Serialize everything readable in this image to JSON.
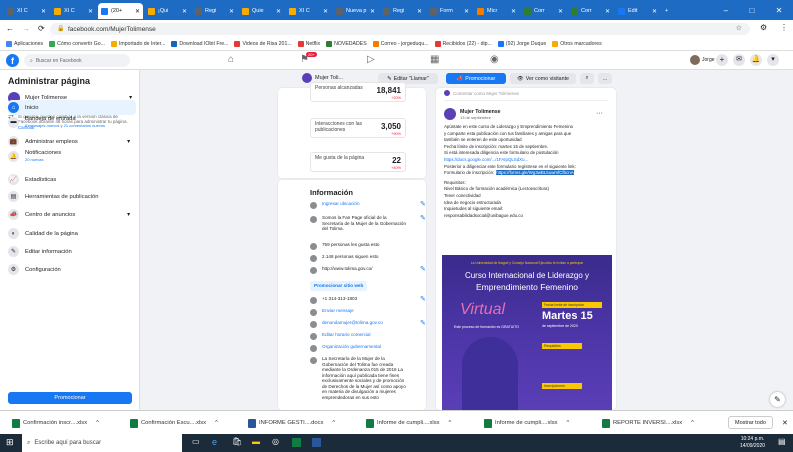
{
  "browser": {
    "tabs": [
      {
        "label": "XI C",
        "color": "#5f6368"
      },
      {
        "label": "XI C",
        "color": "#f9ab00"
      },
      {
        "label": "(20+",
        "color": "#1877f2",
        "active": true
      },
      {
        "label": "¡Qui",
        "color": "#f9ab00"
      },
      {
        "label": "Regi",
        "color": "#5f6368"
      },
      {
        "label": "Quie",
        "color": "#f9ab00"
      },
      {
        "label": "XI C",
        "color": "#f9ab00"
      },
      {
        "label": "Nueva p",
        "color": "#5f6368"
      },
      {
        "label": "Regi",
        "color": "#5f6368"
      },
      {
        "label": "Form",
        "color": "#5f6368"
      },
      {
        "label": "Micr",
        "color": "#f57c00"
      },
      {
        "label": "Corr",
        "color": "#2e7d32"
      },
      {
        "label": "Corr",
        "color": "#2e7d32"
      },
      {
        "label": "Edit",
        "color": "#1877f2"
      }
    ],
    "new_tab": "+",
    "url": "facebook.com/MujerTolimense",
    "bookmarks": [
      {
        "label": "Aplicaciones",
        "color": "#4285f4"
      },
      {
        "label": "Cómo convertir Go...",
        "color": "#34a853"
      },
      {
        "label": "Importado de Inter...",
        "color": "#f9ab00"
      },
      {
        "label": "Download IObit Fre...",
        "color": "#1565c0"
      },
      {
        "label": "Videos de Risa 201...",
        "color": "#e53935"
      },
      {
        "label": "Netflix",
        "color": "#e53935"
      },
      {
        "label": "NOVEDADES",
        "color": "#2e7d32"
      },
      {
        "label": "Correo - jorgeduqu...",
        "color": "#f57c00"
      },
      {
        "label": "Recibidos (22) - dip...",
        "color": "#e53935"
      },
      {
        "label": "(92) Jorge Duque",
        "color": "#1877f2"
      },
      {
        "label": "Otros marcadores",
        "color": "#f9ab00"
      }
    ]
  },
  "fb": {
    "search_placeholder": "Buscar en Facebook",
    "user": "Jorge",
    "notif_badge": "20+"
  },
  "sidebar": {
    "title": "Administrar página",
    "page_name": "Mujer Tolimense",
    "notice": "Si quieres, puedes cambiar a la versión clásica de Facebook durante 48 horas para administrar tu página.",
    "notice_link": "Cambiar",
    "items": [
      {
        "label": "Inicio"
      },
      {
        "label": "Bandeja de entrada",
        "sub": "6 mensajes nuevos y 21 comentarios nuevos"
      },
      {
        "label": "Administrar empleos"
      },
      {
        "label": "Notificaciones",
        "sub": "20 nuevas"
      },
      {
        "label": "Estadísticas"
      },
      {
        "label": "Herramientas de publicación"
      },
      {
        "label": "Centro de anuncios"
      },
      {
        "label": "Calidad de la página"
      },
      {
        "label": "Editar información"
      },
      {
        "label": "Configuración"
      }
    ],
    "promote": "Promocionar"
  },
  "header": {
    "page_short": "Mujer Toli...",
    "edit_btn": "Editar \"Llamar\"",
    "promote_btn": "Promocionar",
    "visitor_btn": "Ver como visitante",
    "more": "..."
  },
  "stats": [
    {
      "label": "Personas alcanzadas",
      "value": "18,841",
      "change": "+20%"
    },
    {
      "label": "Interacciones con las publicaciones",
      "value": "3,050",
      "change": "+90%"
    },
    {
      "label": "Me gusta de la página",
      "value": "22",
      "change": "+40%"
    }
  ],
  "info": {
    "title": "Información",
    "rows": [
      {
        "text": "Ingresar ubicación",
        "link": true
      },
      {
        "text": "Somos la Fan Page oficial de la Secretaría de la Mujer de la Gobernación del Tolima.",
        "link": false
      },
      {
        "text": "759 personas les gusta esto",
        "link": false
      },
      {
        "text": "2.148 personas siguen esto",
        "link": false
      },
      {
        "text": "http://www.tolima.gov.co/",
        "link": false
      },
      {
        "text": "Promocionar sitio web",
        "link": true,
        "button": true
      },
      {
        "text": "+1 314-313-1803",
        "link": false
      },
      {
        "text": "Enviar mensaje",
        "link": true
      },
      {
        "text": "denundamujer@tolima.gov.co",
        "link": true
      },
      {
        "text": "Editar horario comercial",
        "link": true
      },
      {
        "text": "Organización gubernamental",
        "link": true
      },
      {
        "text": "La Secretaría de la Mujer de la Gobernación del Tolima fue creada mediante la Ordenanza 015 de 2016 La información aquí publicada tiene fines exclusivamente sociales y de promoción de Derechos de la Mujer así como apoyo en materia de divulgación a mujeres emprendedoras en sus esto",
        "link": false
      }
    ]
  },
  "post": {
    "composer": "Comentar como Mujer Tolimense",
    "author": "Mujer Tolimense",
    "date": "13 de septiembre · ",
    "lines": [
      "Apúntate en este curso de Liderazgo y Emprendimiento Femenino",
      "y comparte esta publicación con tus familiares y amigas para que",
      "también se enteren de este oportunidad",
      "Fecha límite de inscripción: martes 15 de septiembre.",
      "Si está interesada diligencia este formulario de postulación",
      "https://docs.google.com/.../1FAIpQLSdXu...",
      "Posterior a diligenciar este formulario regístrese en el siguiente link:",
      "Formulario de inscripción:",
      "Requisitos:",
      "Nivel Básico de formación académica (Lectoescritura)",
      "Tener conectividad",
      "Idea de negocio estructurada",
      "Inquietudes al siguiente email:",
      "responsabilidadsocial@unibague.edu.co"
    ],
    "link_highlight": "https://forms.gle/Wg3wBL5uwmfCfbcnA",
    "poster": {
      "top": "La Universidad de Ibagué y Consejo Nacional Ejecutivo te invitan a participar",
      "title1": "Curso Internacional de Liderazgo y",
      "title2": "Emprendimiento Femenino",
      "virtual": "Virtual",
      "fecha_lbl": "Fecha límite de inscripción",
      "fecha": "Martes 15",
      "fecha_sub": "de septiembre de 2020",
      "gratis": "Este proceso de formación es GRATUITO",
      "req": "Requisitos",
      "insc": "Inscripciones"
    }
  },
  "downloads": [
    {
      "name": "Confirmación inscr....xlsx"
    },
    {
      "name": "Confirmación Escu....xlsx"
    },
    {
      "name": "INFORME GESTI....docx"
    },
    {
      "name": "Informe de cumpli....xlsx"
    },
    {
      "name": "Informe de cumpli....xlsx"
    },
    {
      "name": "REPORTE INVERSI....xlsx"
    }
  ],
  "show_all": "Mostrar todo",
  "taskbar": {
    "search": "Escribe aquí para buscar",
    "time": "10:24 p.m.",
    "date": "14/09/2020"
  }
}
